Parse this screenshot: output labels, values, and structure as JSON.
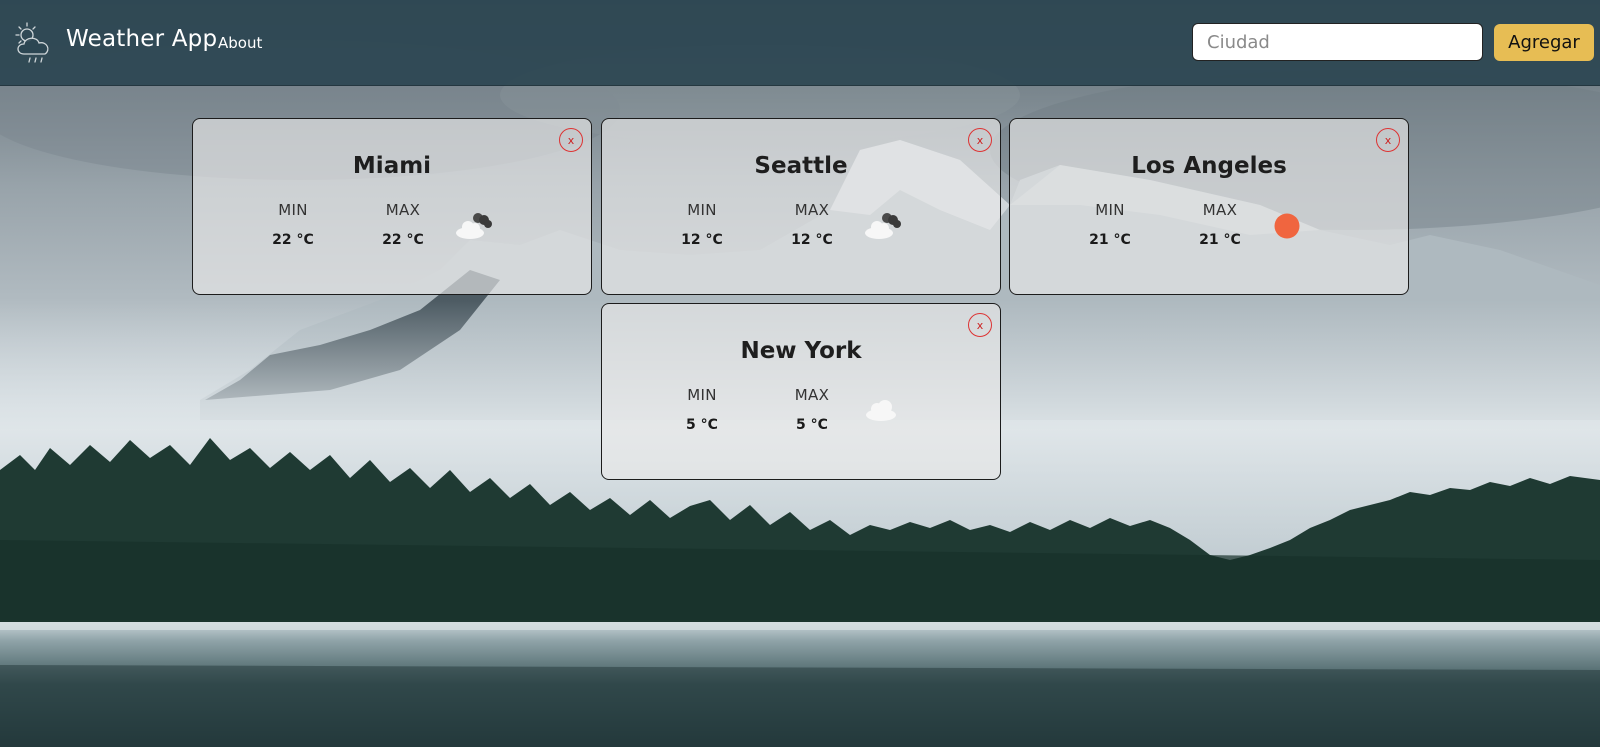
{
  "app": {
    "title": "Weather App",
    "about_label": "About"
  },
  "search": {
    "placeholder": "Ciudad",
    "value": "",
    "add_label": "Agregar"
  },
  "labels": {
    "min": "MIN",
    "max": "MAX",
    "close": "x"
  },
  "cities": [
    {
      "name": "Miami",
      "min": "22 °C",
      "max": "22 °C",
      "icon": "cloud-broken-icon"
    },
    {
      "name": "Seattle",
      "min": "12 °C",
      "max": "12 °C",
      "icon": "cloud-broken-icon"
    },
    {
      "name": "Los Angeles",
      "min": "21 °C",
      "max": "21 °C",
      "icon": "sun-icon"
    },
    {
      "name": "New York",
      "min": "5 °C",
      "max": "5 °C",
      "icon": "cloud-icon"
    }
  ],
  "colors": {
    "navbar": "#2c4652",
    "accent_button": "#e7bd54",
    "close_border": "#dd3333",
    "sun": "#f0653f"
  }
}
